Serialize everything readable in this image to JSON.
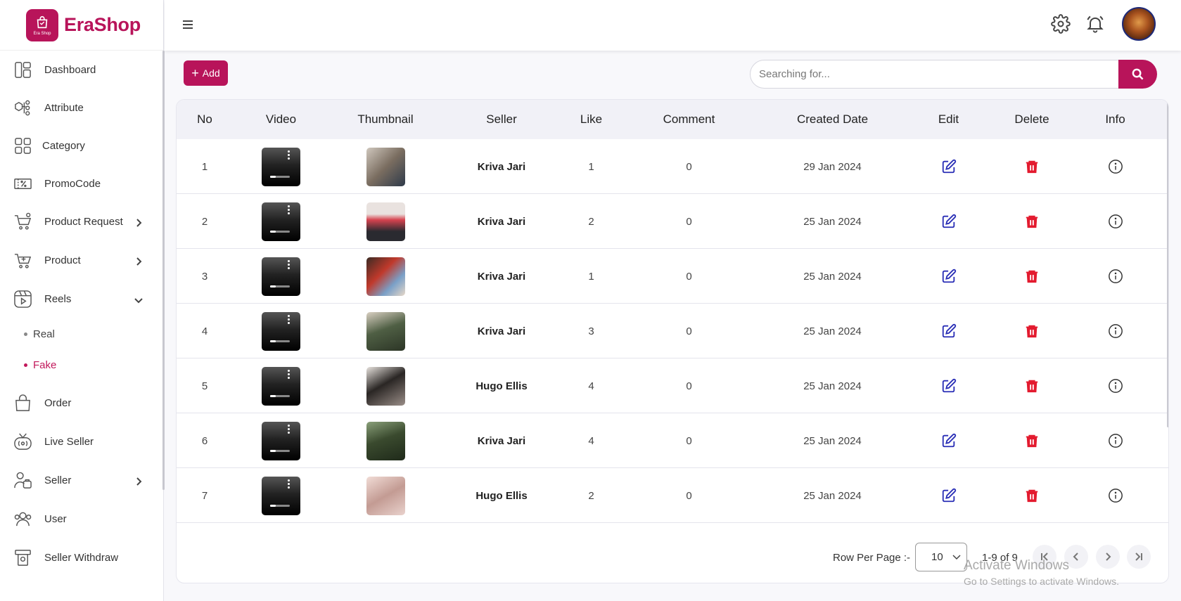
{
  "app": {
    "name": "EraShop",
    "badge_text": "Era Shop"
  },
  "sidebar": {
    "items": [
      {
        "label": "Dashboard",
        "icon": "dashboard-icon"
      },
      {
        "label": "Attribute",
        "icon": "attribute-icon"
      },
      {
        "label": "Category",
        "icon": "category-icon"
      },
      {
        "label": "PromoCode",
        "icon": "promocode-icon"
      },
      {
        "label": "Product Request",
        "icon": "product-request-icon",
        "chevron": "right"
      },
      {
        "label": "Product",
        "icon": "product-icon",
        "chevron": "right"
      },
      {
        "label": "Reels",
        "icon": "reels-icon",
        "chevron": "down"
      },
      {
        "label": "Order",
        "icon": "order-icon"
      },
      {
        "label": "Live Seller",
        "icon": "live-seller-icon"
      },
      {
        "label": "Seller",
        "icon": "seller-icon",
        "chevron": "right"
      },
      {
        "label": "User",
        "icon": "user-icon"
      },
      {
        "label": "Seller Withdraw",
        "icon": "seller-withdraw-icon"
      }
    ],
    "reels_sub": [
      {
        "label": "Real",
        "active": false
      },
      {
        "label": "Fake",
        "active": true
      }
    ]
  },
  "topbar": {
    "icons": [
      "menu-icon",
      "settings-icon",
      "bell-icon",
      "avatar"
    ]
  },
  "toolbar": {
    "add_label": "Add",
    "search_placeholder": "Searching for..."
  },
  "table": {
    "columns": [
      "No",
      "Video",
      "Thumbnail",
      "Seller",
      "Like",
      "Comment",
      "Created Date",
      "Edit",
      "Delete",
      "Info"
    ],
    "rows": [
      {
        "no": "1",
        "seller": "Kriva Jari",
        "like": "1",
        "comment": "0",
        "date": "29 Jan 2024"
      },
      {
        "no": "2",
        "seller": "Kriva Jari",
        "like": "2",
        "comment": "0",
        "date": "25 Jan 2024"
      },
      {
        "no": "3",
        "seller": "Kriva Jari",
        "like": "1",
        "comment": "0",
        "date": "25 Jan 2024"
      },
      {
        "no": "4",
        "seller": "Kriva Jari",
        "like": "3",
        "comment": "0",
        "date": "25 Jan 2024"
      },
      {
        "no": "5",
        "seller": "Hugo Ellis",
        "like": "4",
        "comment": "0",
        "date": "25 Jan 2024"
      },
      {
        "no": "6",
        "seller": "Kriva Jari",
        "like": "4",
        "comment": "0",
        "date": "25 Jan 2024"
      },
      {
        "no": "7",
        "seller": "Hugo Ellis",
        "like": "2",
        "comment": "0",
        "date": "25 Jan 2024"
      }
    ]
  },
  "pagination": {
    "rows_label": "Row Per Page :-",
    "rows_value": "10",
    "range": "1-9 of 9"
  },
  "watermark": {
    "line1": "Activate Windows",
    "line2": "Go to Settings to activate Windows."
  },
  "colors": {
    "brand": "#b8145a",
    "edit": "#2a2fb6",
    "delete": "#e31b2f"
  }
}
